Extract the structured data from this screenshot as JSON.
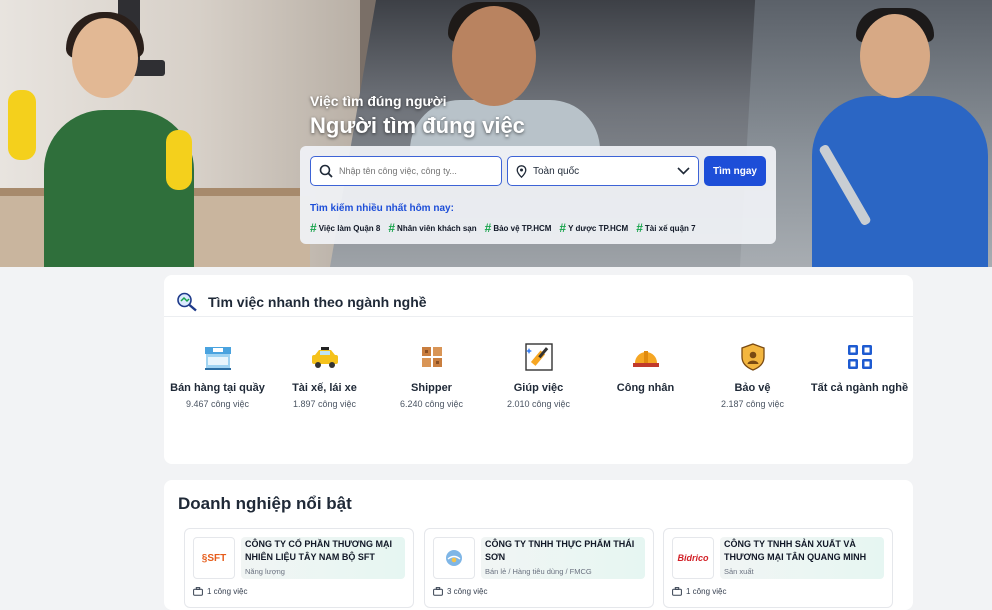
{
  "hero": {
    "subtitle": "Việc tìm đúng người",
    "title": "Người tìm đúng việc"
  },
  "search": {
    "keyword_placeholder": "Nhập tên công việc, công ty...",
    "location_value": "Toàn quốc",
    "button_label": "Tìm ngay",
    "trending_label": "Tìm kiếm nhiều nhất hôm nay:",
    "trending_tags": [
      "Việc làm Quận 8",
      "Nhân viên khách sạn",
      "Bảo vệ TP.HCM",
      "Y dược TP.HCM",
      "Tài xế quận 7"
    ]
  },
  "categories": {
    "title": "Tìm việc nhanh theo ngành nghề",
    "items": [
      {
        "name": "Bán hàng tại quầy",
        "count": "9.467 công việc",
        "icon": "shop-icon"
      },
      {
        "name": "Tài xế, lái xe",
        "count": "1.897 công việc",
        "icon": "taxi-icon"
      },
      {
        "name": "Shipper",
        "count": "6.240 công việc",
        "icon": "package-icon"
      },
      {
        "name": "Giúp việc",
        "count": "2.010 công việc",
        "icon": "cleaning-icon"
      },
      {
        "name": "Công nhân",
        "count": "",
        "icon": "hardhat-icon"
      },
      {
        "name": "Bảo vệ",
        "count": "2.187 công việc",
        "icon": "shield-icon"
      },
      {
        "name": "Tất cả ngành nghề",
        "count": "",
        "icon": "grid-icon"
      }
    ]
  },
  "companies": {
    "title": "Doanh nghiệp nổi bật",
    "items": [
      {
        "name": "CÔNG TY CỔ PHẦN THƯƠNG MẠI NHIÊN LIỆU TÂY NAM BỘ SFT",
        "industry": "Năng lượng",
        "jobs": "1 công việc",
        "logo": "SFT"
      },
      {
        "name": "CÔNG TY TNHH THỰC PHẨM THÁI SƠN",
        "industry": "Bán lẻ / Hàng tiêu dùng / FMCG",
        "jobs": "3 công việc",
        "logo": ""
      },
      {
        "name": "CÔNG TY TNHH SẢN XUẤT VÀ THƯƠNG MẠI TÂN QUANG MINH",
        "industry": "Sản xuất",
        "jobs": "1 công việc",
        "logo": "Bidrico"
      }
    ]
  },
  "colors": {
    "primary": "#1d4ed8",
    "tag_hash": "#16a34a",
    "page_bg": "#f2f3f5"
  }
}
